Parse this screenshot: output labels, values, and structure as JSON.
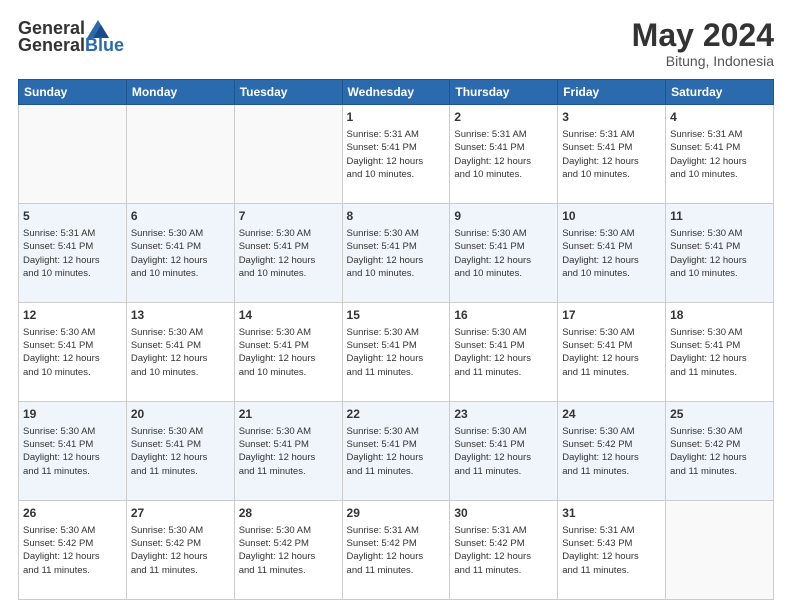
{
  "header": {
    "logo_general": "General",
    "logo_blue": "Blue",
    "month_title": "May 2024",
    "location": "Bitung, Indonesia"
  },
  "days_of_week": [
    "Sunday",
    "Monday",
    "Tuesday",
    "Wednesday",
    "Thursday",
    "Friday",
    "Saturday"
  ],
  "weeks": [
    [
      {
        "day": "",
        "info": ""
      },
      {
        "day": "",
        "info": ""
      },
      {
        "day": "",
        "info": ""
      },
      {
        "day": "1",
        "info": "Sunrise: 5:31 AM\nSunset: 5:41 PM\nDaylight: 12 hours\nand 10 minutes."
      },
      {
        "day": "2",
        "info": "Sunrise: 5:31 AM\nSunset: 5:41 PM\nDaylight: 12 hours\nand 10 minutes."
      },
      {
        "day": "3",
        "info": "Sunrise: 5:31 AM\nSunset: 5:41 PM\nDaylight: 12 hours\nand 10 minutes."
      },
      {
        "day": "4",
        "info": "Sunrise: 5:31 AM\nSunset: 5:41 PM\nDaylight: 12 hours\nand 10 minutes."
      }
    ],
    [
      {
        "day": "5",
        "info": "Sunrise: 5:31 AM\nSunset: 5:41 PM\nDaylight: 12 hours\nand 10 minutes."
      },
      {
        "day": "6",
        "info": "Sunrise: 5:30 AM\nSunset: 5:41 PM\nDaylight: 12 hours\nand 10 minutes."
      },
      {
        "day": "7",
        "info": "Sunrise: 5:30 AM\nSunset: 5:41 PM\nDaylight: 12 hours\nand 10 minutes."
      },
      {
        "day": "8",
        "info": "Sunrise: 5:30 AM\nSunset: 5:41 PM\nDaylight: 12 hours\nand 10 minutes."
      },
      {
        "day": "9",
        "info": "Sunrise: 5:30 AM\nSunset: 5:41 PM\nDaylight: 12 hours\nand 10 minutes."
      },
      {
        "day": "10",
        "info": "Sunrise: 5:30 AM\nSunset: 5:41 PM\nDaylight: 12 hours\nand 10 minutes."
      },
      {
        "day": "11",
        "info": "Sunrise: 5:30 AM\nSunset: 5:41 PM\nDaylight: 12 hours\nand 10 minutes."
      }
    ],
    [
      {
        "day": "12",
        "info": "Sunrise: 5:30 AM\nSunset: 5:41 PM\nDaylight: 12 hours\nand 10 minutes."
      },
      {
        "day": "13",
        "info": "Sunrise: 5:30 AM\nSunset: 5:41 PM\nDaylight: 12 hours\nand 10 minutes."
      },
      {
        "day": "14",
        "info": "Sunrise: 5:30 AM\nSunset: 5:41 PM\nDaylight: 12 hours\nand 10 minutes."
      },
      {
        "day": "15",
        "info": "Sunrise: 5:30 AM\nSunset: 5:41 PM\nDaylight: 12 hours\nand 11 minutes."
      },
      {
        "day": "16",
        "info": "Sunrise: 5:30 AM\nSunset: 5:41 PM\nDaylight: 12 hours\nand 11 minutes."
      },
      {
        "day": "17",
        "info": "Sunrise: 5:30 AM\nSunset: 5:41 PM\nDaylight: 12 hours\nand 11 minutes."
      },
      {
        "day": "18",
        "info": "Sunrise: 5:30 AM\nSunset: 5:41 PM\nDaylight: 12 hours\nand 11 minutes."
      }
    ],
    [
      {
        "day": "19",
        "info": "Sunrise: 5:30 AM\nSunset: 5:41 PM\nDaylight: 12 hours\nand 11 minutes."
      },
      {
        "day": "20",
        "info": "Sunrise: 5:30 AM\nSunset: 5:41 PM\nDaylight: 12 hours\nand 11 minutes."
      },
      {
        "day": "21",
        "info": "Sunrise: 5:30 AM\nSunset: 5:41 PM\nDaylight: 12 hours\nand 11 minutes."
      },
      {
        "day": "22",
        "info": "Sunrise: 5:30 AM\nSunset: 5:41 PM\nDaylight: 12 hours\nand 11 minutes."
      },
      {
        "day": "23",
        "info": "Sunrise: 5:30 AM\nSunset: 5:41 PM\nDaylight: 12 hours\nand 11 minutes."
      },
      {
        "day": "24",
        "info": "Sunrise: 5:30 AM\nSunset: 5:42 PM\nDaylight: 12 hours\nand 11 minutes."
      },
      {
        "day": "25",
        "info": "Sunrise: 5:30 AM\nSunset: 5:42 PM\nDaylight: 12 hours\nand 11 minutes."
      }
    ],
    [
      {
        "day": "26",
        "info": "Sunrise: 5:30 AM\nSunset: 5:42 PM\nDaylight: 12 hours\nand 11 minutes."
      },
      {
        "day": "27",
        "info": "Sunrise: 5:30 AM\nSunset: 5:42 PM\nDaylight: 12 hours\nand 11 minutes."
      },
      {
        "day": "28",
        "info": "Sunrise: 5:30 AM\nSunset: 5:42 PM\nDaylight: 12 hours\nand 11 minutes."
      },
      {
        "day": "29",
        "info": "Sunrise: 5:31 AM\nSunset: 5:42 PM\nDaylight: 12 hours\nand 11 minutes."
      },
      {
        "day": "30",
        "info": "Sunrise: 5:31 AM\nSunset: 5:42 PM\nDaylight: 12 hours\nand 11 minutes."
      },
      {
        "day": "31",
        "info": "Sunrise: 5:31 AM\nSunset: 5:43 PM\nDaylight: 12 hours\nand 11 minutes."
      },
      {
        "day": "",
        "info": ""
      }
    ]
  ]
}
